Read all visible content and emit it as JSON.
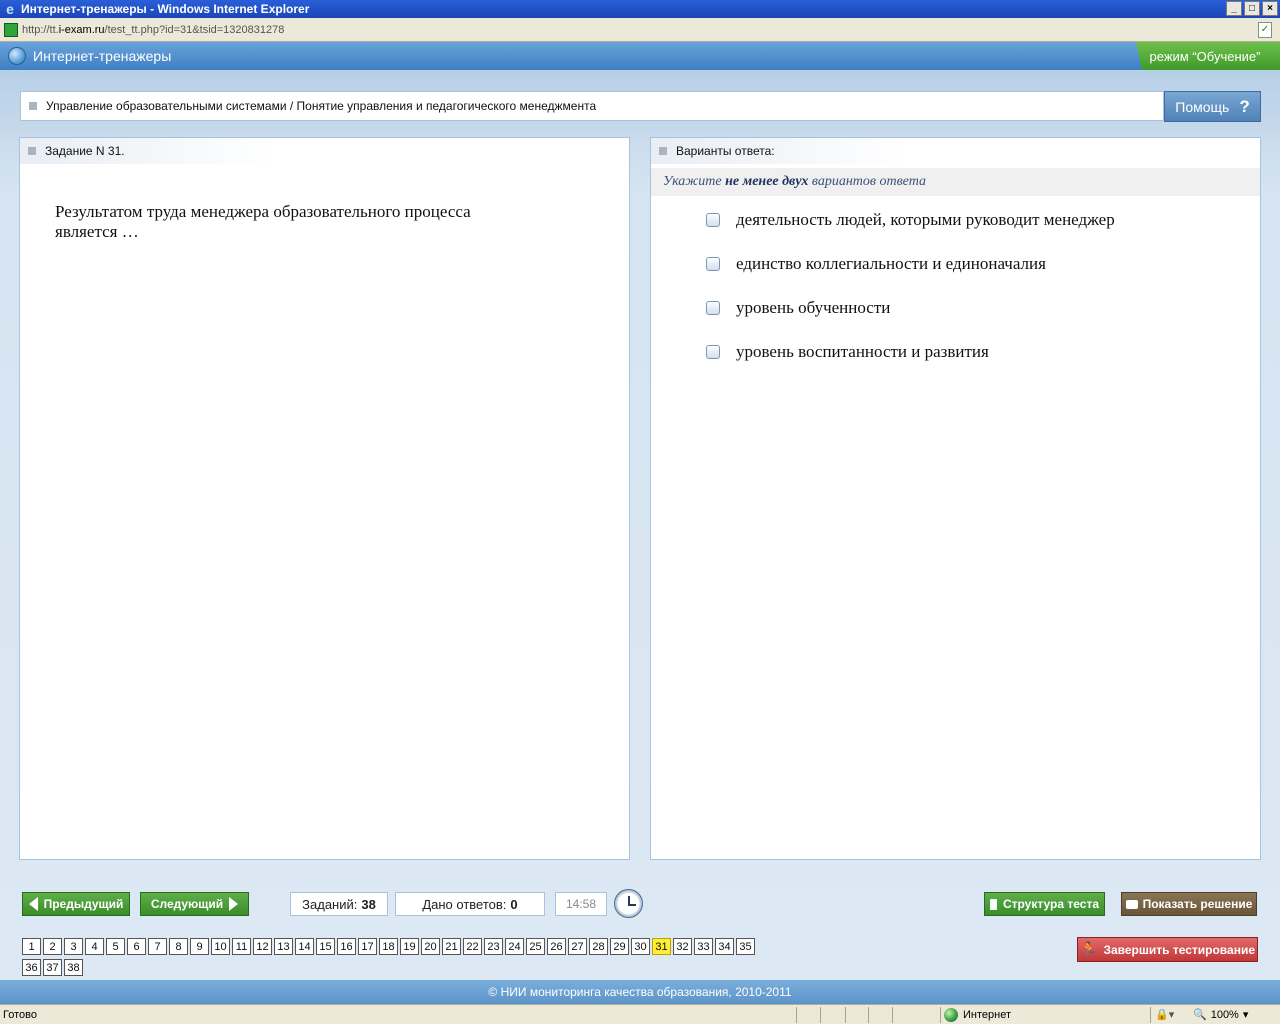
{
  "window": {
    "title": "Интернет-тренажеры - Windows Internet Explorer",
    "url_prefix": "http://tt.",
    "url_host": "i-exam.ru",
    "url_path": "/test_tt.php?id=31&tsid=1320831278"
  },
  "header": {
    "app_title": "Интернет-тренажеры",
    "mode": "режим “Обучение”"
  },
  "breadcrumb": {
    "text": "Управление образовательными системами / Понятие управления и педагогического менеджмента"
  },
  "help": {
    "label": "Помощь",
    "icon_char": "?"
  },
  "task": {
    "heading": "Задание N 31.",
    "question": "Результатом труда менеджера образовательного процесса является …"
  },
  "answers": {
    "heading": "Варианты ответа:",
    "hint_prefix": "Укажите",
    "hint_bold": "не менее двух",
    "hint_suffix": "вариантов ответа",
    "options": [
      {
        "label": "деятельность людей, которыми руководит менеджер",
        "checked": false
      },
      {
        "label": "единство коллегиальности и единоначалия",
        "checked": false
      },
      {
        "label": "уровень обученности",
        "checked": false
      },
      {
        "label": "уровень воспитанности и развития",
        "checked": false
      }
    ]
  },
  "toolbar": {
    "prev_label": "Предыдущий",
    "next_label": "Следующий",
    "tasks_label": "Заданий:",
    "tasks_count": "38",
    "answers_label": "Дано ответов:",
    "answers_count": "0",
    "timer": "14:58",
    "structure_label": "Структура теста",
    "solution_label": "Показать решение",
    "finish_label": "Завершить тестирование"
  },
  "pager": {
    "pages": [
      "1",
      "2",
      "3",
      "4",
      "5",
      "6",
      "7",
      "8",
      "9",
      "10",
      "11",
      "12",
      "13",
      "14",
      "15",
      "16",
      "17",
      "18",
      "19",
      "20",
      "21",
      "22",
      "23",
      "24",
      "25",
      "26",
      "27",
      "28",
      "29",
      "30",
      "31",
      "32",
      "33",
      "34",
      "35",
      "36",
      "37",
      "38"
    ],
    "current": "31"
  },
  "footer": {
    "text": "© НИИ мониторинга качества образования, 2010-2011"
  },
  "statusbar": {
    "status": "Готово",
    "zone": "Интернет",
    "zoom": "100%"
  }
}
